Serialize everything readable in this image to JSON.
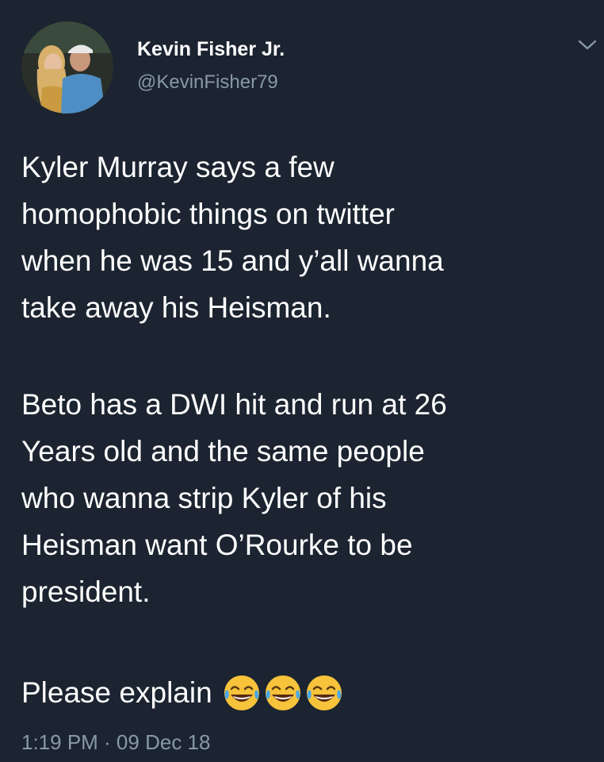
{
  "tweet": {
    "display_name": "Kevin Fisher Jr.",
    "handle": "@KevinFisher79",
    "paragraphs": [
      "Kyler Murray says a few\nhomophobic things on twitter\nwhen he was 15 and y’all wanna\ntake away his Heisman.",
      "Beto has a DWI hit and run at 26\nYears old and the same people\nwho wanna strip Kyler of his\nHeisman want O’Rourke to be\npresident.",
      "Please explain"
    ],
    "emojis": [
      "face-with-tears-of-joy",
      "face-with-tears-of-joy",
      "face-with-tears-of-joy"
    ],
    "timestamp": "1:19 PM · 09 Dec 18",
    "menu_icon": "chevron-down-icon"
  },
  "colors": {
    "background": "#1b2430",
    "primary_text": "#ffffff",
    "secondary_text": "#8899a6",
    "emoji_face": "#f7c33b",
    "emoji_tear": "#4aa8e8"
  }
}
